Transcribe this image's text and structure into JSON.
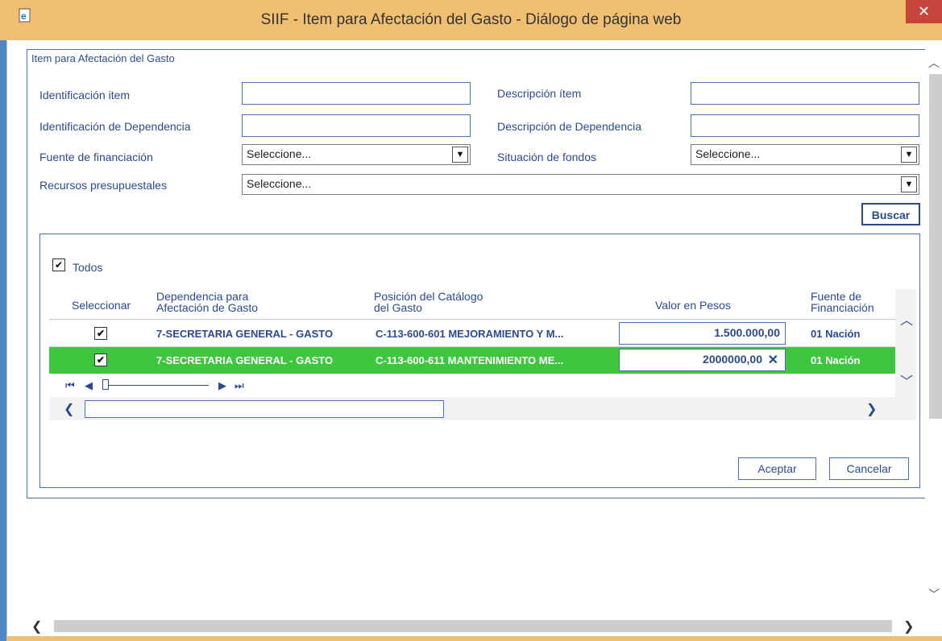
{
  "window": {
    "title": "SIIF - Item para Afectación del Gasto - Diálogo de página web",
    "close_glyph": "✕",
    "icon": "ie-page-icon"
  },
  "form": {
    "legend": "Item para Afectación del Gasto",
    "fields": {
      "identificacion_item": {
        "label": "Identificación item",
        "value": ""
      },
      "descripcion_item": {
        "label": "Descripción ítem",
        "value": ""
      },
      "identificacion_dependencia": {
        "label": "Identificación de Dependencia",
        "value": ""
      },
      "descripcion_dependencia": {
        "label": "Descripción de Dependencia",
        "value": ""
      },
      "fuente_financiacion": {
        "label": "Fuente de financiación",
        "selected": "Seleccione..."
      },
      "situacion_fondos": {
        "label": "Situación de fondos",
        "selected": "Seleccione..."
      },
      "recursos_presupuestales": {
        "label": "Recursos presupuestales",
        "selected": "Seleccione..."
      }
    },
    "buscar_label": "Buscar"
  },
  "grid": {
    "todos_label": "Todos",
    "todos_checked": true,
    "columns": {
      "seleccionar": "Seleccionar",
      "dependencia_l1": "Dependencia para",
      "dependencia_l2": "Afectación de Gasto",
      "posicion_l1": "Posición del Catálogo",
      "posicion_l2": "del Gasto",
      "valor": "Valor en Pesos",
      "fuente_l1": "Fuente de",
      "fuente_l2": "Financiación"
    },
    "rows": [
      {
        "checked": true,
        "dependencia": "7-SECRETARIA GENERAL - GASTO",
        "posicion": "C-113-600-601 MEJORAMIENTO Y M...",
        "valor": "1.500.000,00",
        "fuente": "01 Nación",
        "selected": false
      },
      {
        "checked": true,
        "dependencia": "7-SECRETARIA GENERAL - GASTO",
        "posicion": "C-113-600-611 MANTENIMIENTO ME...",
        "valor": "2000000,00",
        "fuente": "01 Nación",
        "selected": true
      }
    ]
  },
  "buttons": {
    "aceptar": "Aceptar",
    "cancelar": "Cancelar"
  },
  "colors": {
    "selected_row": "#3ec63e",
    "label_blue": "#2a4a90",
    "border_blue": "#4a6fb5",
    "titlebar": "#f0bf72",
    "close_red": "#c7453c"
  }
}
